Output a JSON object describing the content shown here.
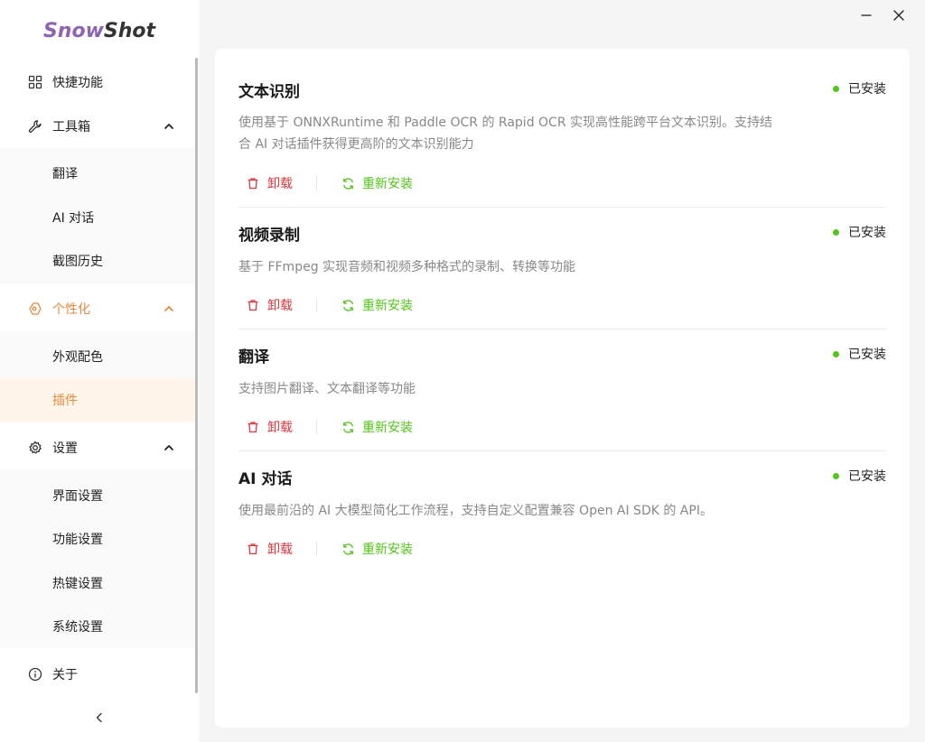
{
  "app": {
    "logo_part1": "Snow",
    "logo_part2": "Shot"
  },
  "window": {
    "minimize_icon": "minimize-icon",
    "close_icon": "close-icon"
  },
  "sidebar": {
    "items": [
      {
        "label": "快捷功能",
        "icon": "grid-icon"
      },
      {
        "label": "工具箱",
        "icon": "wrench-icon",
        "expanded": true,
        "children": [
          "翻译",
          "AI 对话",
          "截图历史"
        ]
      },
      {
        "label": "个性化",
        "icon": "palette-icon",
        "expanded": true,
        "active": true,
        "children": [
          "外观配色",
          "插件"
        ],
        "active_child": "插件"
      },
      {
        "label": "设置",
        "icon": "gear-icon",
        "expanded": true,
        "children": [
          "界面设置",
          "功能设置",
          "热键设置",
          "系统设置"
        ]
      },
      {
        "label": "关于",
        "icon": "info-icon"
      }
    ],
    "collapse_icon": "chevron-left-icon"
  },
  "colors": {
    "accent": "#e68a3d",
    "success": "#52c41a",
    "danger": "#d9363e",
    "logo_purple": "#8e63b6"
  },
  "plugins": [
    {
      "title": "文本识别",
      "status": "已安装",
      "desc_line1": "使用基于 ONNXRuntime 和 Paddle OCR 的 Rapid OCR 实现高性能跨平台文本识别。支持结",
      "desc_line2": "合 AI 对话插件获得更高阶的文本识别能力",
      "uninstall": "卸载",
      "reinstall": "重新安装"
    },
    {
      "title": "视频录制",
      "status": "已安装",
      "desc_line1": "基于 FFmpeg 实现音频和视频多种格式的录制、转换等功能",
      "uninstall": "卸载",
      "reinstall": "重新安装"
    },
    {
      "title": "翻译",
      "status": "已安装",
      "desc_line1": "支持图片翻译、文本翻译等功能",
      "uninstall": "卸载",
      "reinstall": "重新安装"
    },
    {
      "title": "AI 对话",
      "status": "已安装",
      "desc_line1": "使用最前沿的 AI 大模型简化工作流程，支持自定义配置兼容 Open AI SDK 的 API。",
      "uninstall": "卸载",
      "reinstall": "重新安装"
    }
  ]
}
